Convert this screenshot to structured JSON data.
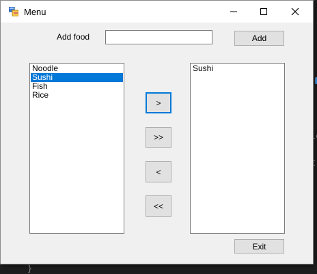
{
  "window": {
    "title": "Menu",
    "icon": "form-app-icon"
  },
  "form": {
    "add_food_label": "Add food",
    "food_input": {
      "value": "",
      "placeholder": ""
    },
    "add_button_label": "Add",
    "exit_button_label": "Exit"
  },
  "left_list": {
    "items": [
      "Noodle",
      "Sushi",
      "Fish",
      "Rice"
    ],
    "selected_index": 1
  },
  "right_list": {
    "items": [
      "Sushi"
    ]
  },
  "move_buttons": {
    "move_right": ">",
    "move_all_right": ">>",
    "move_left": "<",
    "move_all_left": "<<"
  },
  "colors": {
    "selection": "#0078d7",
    "window_bg": "#f0f0f0",
    "editor_bg": "#1e1e1e"
  }
}
